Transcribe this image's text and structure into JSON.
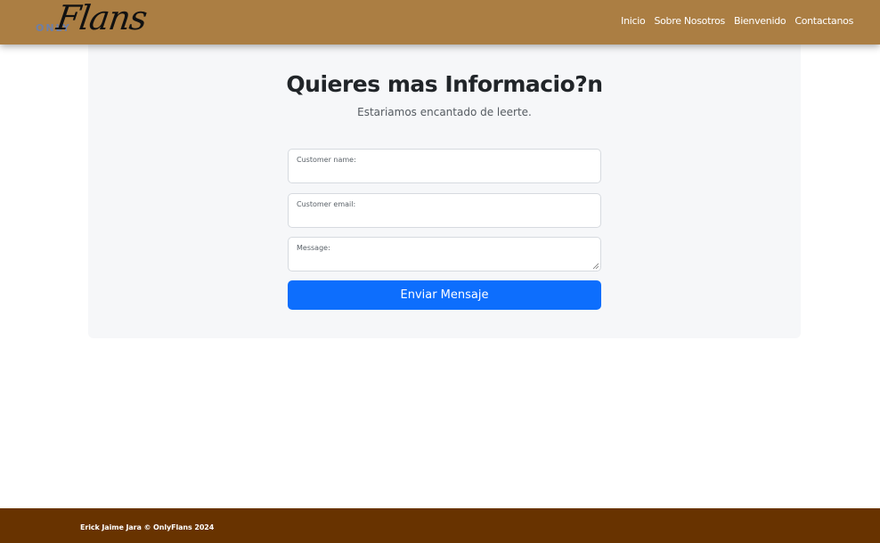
{
  "brand": {
    "small_text": "ONLY",
    "big_text": "Flans"
  },
  "nav": {
    "items": [
      {
        "label": "Inicio"
      },
      {
        "label": "Sobre Nosotros"
      },
      {
        "label": "Bienvenido"
      },
      {
        "label": "Contactanos"
      }
    ]
  },
  "contact": {
    "title": "Quieres mas Informacio?n",
    "subtitle": "Estariamos encantado de leerte.",
    "fields": {
      "name_label": "Customer name:",
      "email_label": "Customer email:",
      "message_label": "Message:"
    },
    "submit_label": "Enviar Mensaje"
  },
  "footer": {
    "text": "Erick Jaime Jara © OnlyFlans 2024"
  },
  "colors": {
    "navbar": "#ab7e43",
    "footer": "#683300",
    "button": "#0d6efd",
    "card": "#f6f7f9"
  }
}
